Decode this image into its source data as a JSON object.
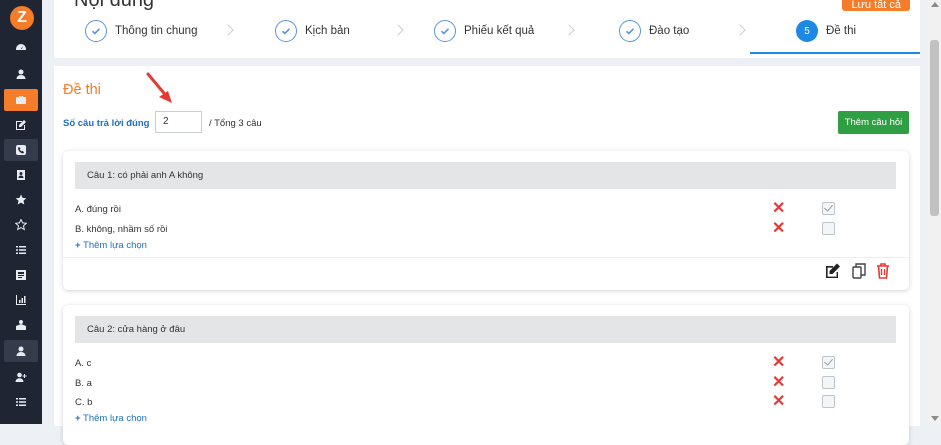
{
  "page": {
    "title": "Nội dung",
    "save_all": "Lưu tất cả"
  },
  "logo": "Z",
  "sidebar": {
    "items": [
      {
        "icon": "dashboard-icon"
      },
      {
        "icon": "user-icon"
      },
      {
        "icon": "briefcase-icon"
      },
      {
        "icon": "edit-icon"
      },
      {
        "icon": "phone-icon"
      },
      {
        "icon": "contact-book-icon"
      },
      {
        "icon": "star-check-icon"
      },
      {
        "icon": "star-icon"
      },
      {
        "icon": "list-icon"
      },
      {
        "icon": "news-icon"
      },
      {
        "icon": "bar-chart-icon"
      },
      {
        "icon": "training-icon"
      },
      {
        "icon": "user-circle-icon"
      },
      {
        "icon": "add-user-icon"
      },
      {
        "icon": "list-alt-icon"
      }
    ]
  },
  "steps": [
    {
      "label": "Thông tin chung",
      "state": "done"
    },
    {
      "label": "Kịch bản",
      "state": "done"
    },
    {
      "label": "Phiếu kết quả",
      "state": "done"
    },
    {
      "label": "Đào tạo",
      "state": "done"
    },
    {
      "label": "Đề thi",
      "state": "active",
      "number": "5"
    }
  ],
  "exam": {
    "title": "Đề thi",
    "correct_label": "Số câu trả lời đúng",
    "correct_value": "2",
    "total_text": "/ Tổng 3 câu",
    "add_question": "Thêm câu hỏi"
  },
  "questions": [
    {
      "title": "Câu 1: có phải anh A không",
      "options": [
        {
          "text": "A. đúng rồi",
          "checked": true
        },
        {
          "text": "B. không, nhầm số rồi",
          "checked": false
        }
      ],
      "add_option": "Thêm lựa chọn"
    },
    {
      "title": "Câu 2: cửa hàng ở đâu",
      "options": [
        {
          "text": "A. c",
          "checked": true
        },
        {
          "text": "B. a",
          "checked": false
        },
        {
          "text": "C. b",
          "checked": false
        }
      ],
      "add_option": "Thêm lựa chọn"
    }
  ],
  "colors": {
    "accent": "#f57c28",
    "primary": "#1e88e5",
    "success": "#2ea043",
    "danger": "#e53935",
    "sidebar": "#1f2532"
  }
}
